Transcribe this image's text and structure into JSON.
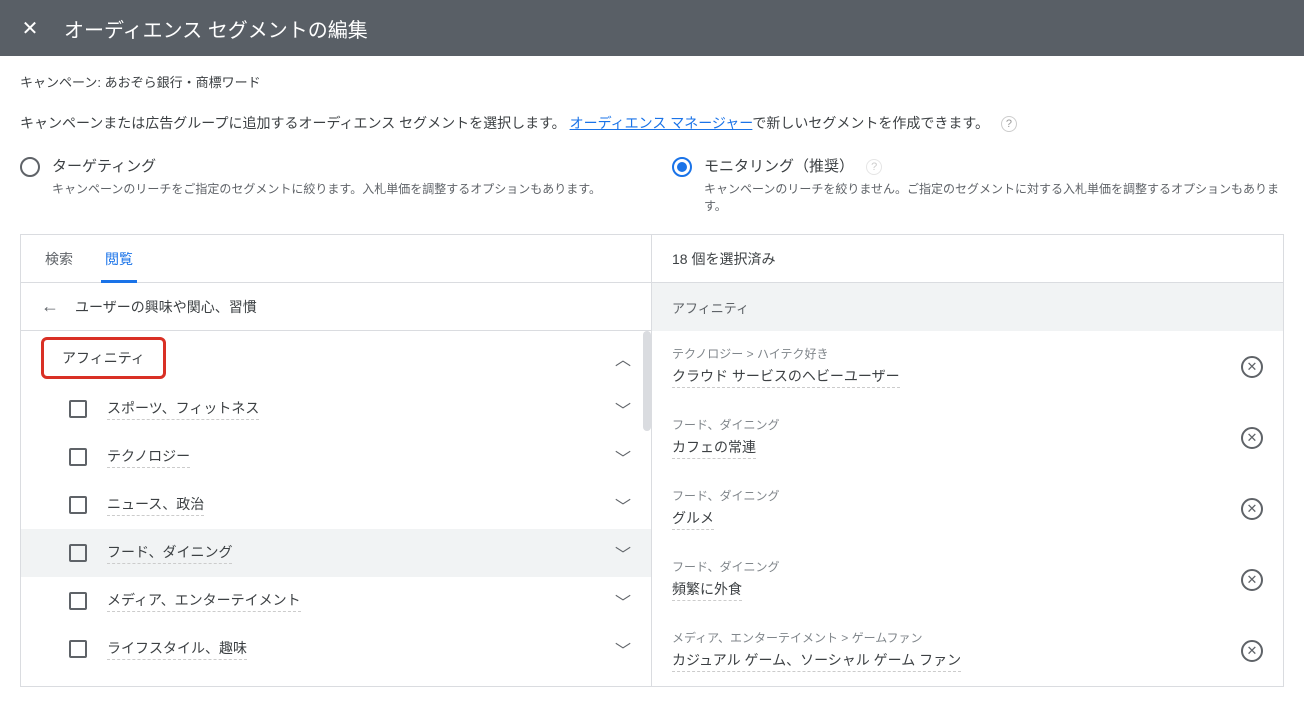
{
  "header": {
    "title": "オーディエンス セグメントの編集"
  },
  "campaign": {
    "label": "キャンペーン:",
    "name": "あおぞら銀行・商標ワード"
  },
  "instruction": {
    "prefix": "キャンペーンまたは広告グループに追加するオーディエンス セグメントを選択します。",
    "link": "オーディエンス マネージャー",
    "suffix": "で新しいセグメントを作成できます。"
  },
  "options": {
    "targeting": {
      "title": "ターゲティング",
      "desc": "キャンペーンのリーチをご指定のセグメントに絞ります。入札単価を調整するオプションもあります。"
    },
    "monitoring": {
      "title": "モニタリング（推奨）",
      "desc": "キャンペーンのリーチを絞りません。ご指定のセグメントに対する入札単価を調整するオプションもあります。"
    }
  },
  "tabs": {
    "search": "検索",
    "browse": "閲覧"
  },
  "breadcrumb": "ユーザーの興味や関心、習慣",
  "affinity_header": "アフィニティ",
  "categories": [
    {
      "label": "スポーツ、フィットネス"
    },
    {
      "label": "テクノロジー"
    },
    {
      "label": "ニュース、政治"
    },
    {
      "label": "フード、ダイニング",
      "hover": true
    },
    {
      "label": "メディア、エンターテイメント"
    },
    {
      "label": "ライフスタイル、趣味"
    }
  ],
  "selected": {
    "count_label": "18 個を選択済み",
    "section": "アフィニティ",
    "items": [
      {
        "cat": "テクノロジー > ハイテク好き",
        "name": "クラウド サービスのヘビーユーザー"
      },
      {
        "cat": "フード、ダイニング",
        "name": "カフェの常連"
      },
      {
        "cat": "フード、ダイニング",
        "name": "グルメ"
      },
      {
        "cat": "フード、ダイニング",
        "name": "頻繁に外食"
      },
      {
        "cat": "メディア、エンターテイメント > ゲームファン",
        "name": "カジュアル ゲーム、ソーシャル ゲーム ファン"
      }
    ]
  }
}
